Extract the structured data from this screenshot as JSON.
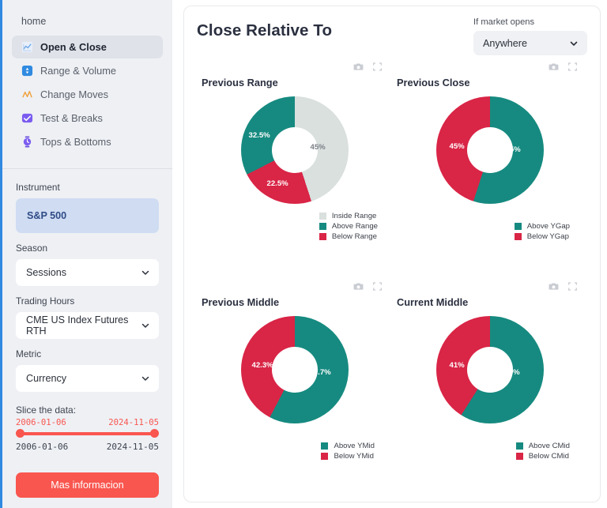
{
  "sidebar": {
    "home_label": "home",
    "nav": [
      {
        "label": "Open & Close",
        "icon": "line-chart-icon",
        "active": true
      },
      {
        "label": "Range & Volume",
        "icon": "updown-arrows-icon",
        "active": false
      },
      {
        "label": "Change Moves",
        "icon": "zigzag-icon",
        "active": false
      },
      {
        "label": "Test & Breaks",
        "icon": "check-square-icon",
        "active": false
      },
      {
        "label": "Tops & Bottoms",
        "icon": "stopwatch-icon",
        "active": false
      }
    ],
    "instrument_label": "Instrument",
    "instrument_value": "S&P 500",
    "season_label": "Season",
    "season_value": "Sessions",
    "trading_hours_label": "Trading Hours",
    "trading_hours_value": "CME US Index Futures RTH",
    "metric_label": "Metric",
    "metric_value": "Currency",
    "slice_label": "Slice the data:",
    "slider_start": "2006-01-06",
    "slider_end": "2024-11-05",
    "range_min": "2006-01-06",
    "range_max": "2024-11-05",
    "cta_label": "Mas informacion"
  },
  "header": {
    "title": "Close Relative To",
    "market_label": "If market opens",
    "market_value": "Anywhere"
  },
  "colors": {
    "teal": "#168a80",
    "red": "#d92546",
    "gray": "#d9e0de",
    "accent_red": "#f9564f",
    "rail_blue": "#2f8ae0"
  },
  "chart_data": [
    {
      "type": "pie",
      "title": "Previous Range",
      "categories": [
        "Inside Range",
        "Above Range",
        "Below Range"
      ],
      "values": [
        45,
        32.5,
        22.5
      ],
      "labels": [
        "45%",
        "32.5%",
        "22.5%"
      ],
      "colors": [
        "#d9e0de",
        "#168a80",
        "#d92546"
      ],
      "legend_position": "bottom-right",
      "donut": true
    },
    {
      "type": "pie",
      "title": "Previous Close",
      "categories": [
        "Above YGap",
        "Below YGap"
      ],
      "values": [
        55,
        45
      ],
      "labels": [
        "55%",
        "45%"
      ],
      "colors": [
        "#168a80",
        "#d92546"
      ],
      "legend_position": "bottom-right",
      "donut": true
    },
    {
      "type": "pie",
      "title": "Previous Middle",
      "categories": [
        "Above YMid",
        "Below YMid"
      ],
      "values": [
        57.7,
        42.3
      ],
      "labels": [
        "57.7%",
        "42.3%"
      ],
      "colors": [
        "#168a80",
        "#d92546"
      ],
      "legend_position": "bottom-right",
      "donut": true
    },
    {
      "type": "pie",
      "title": "Current Middle",
      "categories": [
        "Above CMid",
        "Below CMid"
      ],
      "values": [
        59,
        41
      ],
      "labels": [
        "59%",
        "41%"
      ],
      "colors": [
        "#168a80",
        "#d92546"
      ],
      "legend_position": "bottom-right",
      "donut": true
    }
  ]
}
